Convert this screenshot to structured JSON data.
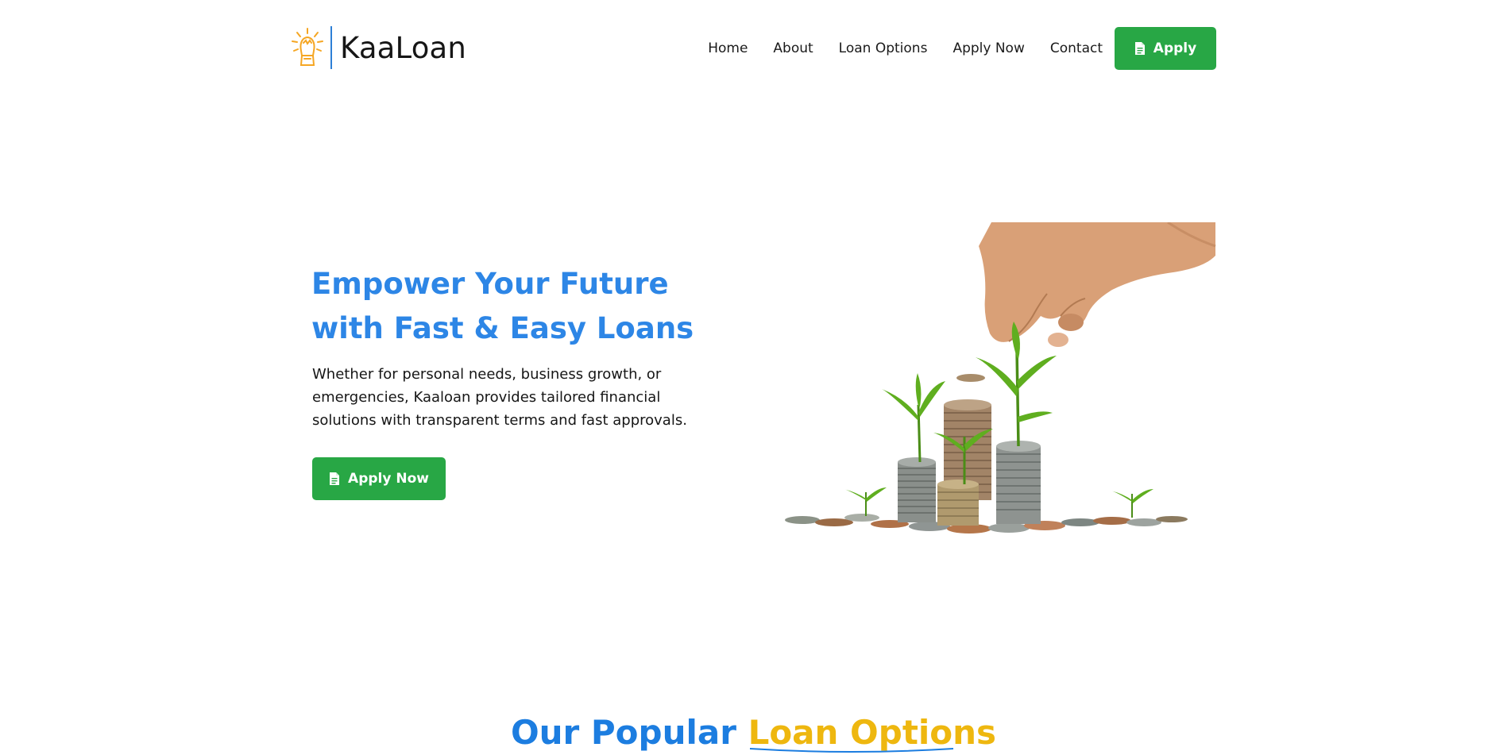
{
  "brand": {
    "name": "KaaLoan",
    "colors": {
      "primary_blue": "#2d86e6",
      "button_green": "#28a745",
      "accent_yellow": "#eeb70f"
    }
  },
  "nav": {
    "items": [
      {
        "label": "Home"
      },
      {
        "label": "About"
      },
      {
        "label": "Loan Options"
      },
      {
        "label": "Apply Now"
      },
      {
        "label": "Contact"
      }
    ],
    "apply_button": {
      "label": "Apply",
      "icon": "document-icon"
    }
  },
  "hero": {
    "title_line1": "Empower Your Future",
    "title_line2": "with Fast & Easy Loans",
    "description": "Whether for personal needs, business growth, or emergencies, Kaaloan provides tailored financial solutions with transparent terms and fast approvals.",
    "cta": {
      "label": "Apply Now",
      "icon": "document-icon"
    },
    "image": "hand-placing-coin-on-stacks-with-plants"
  },
  "loan_section": {
    "title_part1": "Our Popular",
    "title_part2": "Loan Options"
  }
}
